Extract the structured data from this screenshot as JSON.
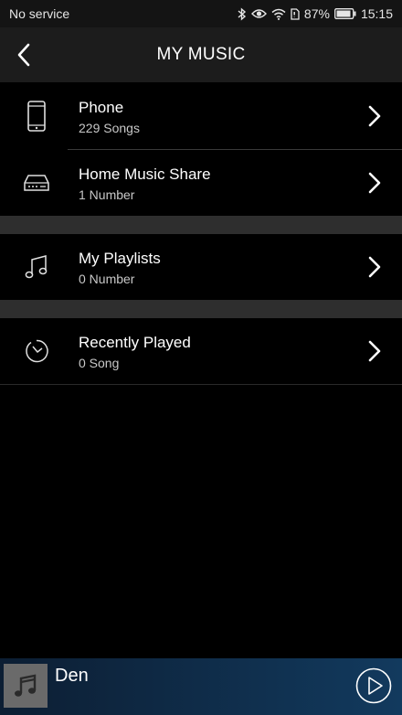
{
  "status_bar": {
    "carrier": "No service",
    "battery_percent": "87%",
    "time": "15:15",
    "icons": [
      "bluetooth-icon",
      "eye-icon",
      "wifi-icon",
      "sim-icon",
      "battery-icon"
    ]
  },
  "header": {
    "title": "MY MUSIC",
    "back_icon": "chevron-left-icon"
  },
  "rows": [
    {
      "title": "Phone",
      "subtitle": "229 Songs",
      "icon": "phone-icon"
    },
    {
      "title": "Home Music Share",
      "subtitle": "1 Number",
      "icon": "server-icon"
    },
    {
      "title": "My Playlists",
      "subtitle": "0 Number",
      "icon": "music-note-icon"
    },
    {
      "title": "Recently Played",
      "subtitle": "0 Song",
      "icon": "clock-icon"
    }
  ],
  "player": {
    "track_title": "Den",
    "art_icon": "music-note-icon",
    "play_icon": "play-icon"
  },
  "colors": {
    "background": "#000000",
    "header": "#1c1c1c",
    "section_gap": "#2e2e2e",
    "player_start": "#0c1e33",
    "player_end": "#123a5e"
  }
}
